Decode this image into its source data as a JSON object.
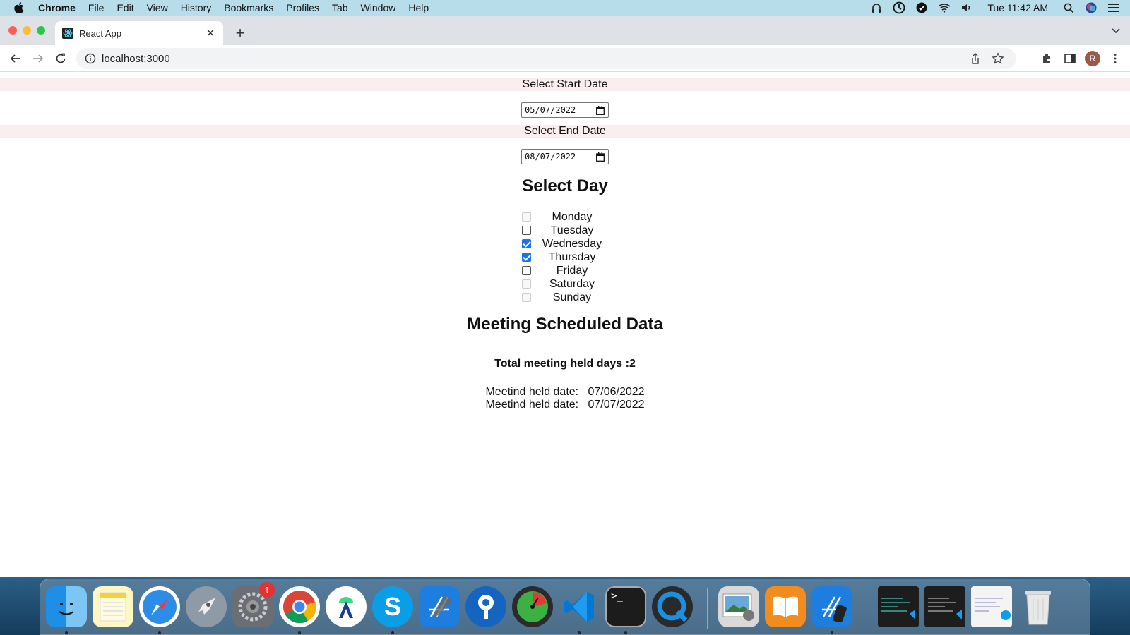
{
  "menubar": {
    "app": "Chrome",
    "items": [
      "File",
      "Edit",
      "View",
      "History",
      "Bookmarks",
      "Profiles",
      "Tab",
      "Window",
      "Help"
    ],
    "clock": "Tue 11:42 AM"
  },
  "browser": {
    "tab_title": "React App",
    "url": "localhost:3000",
    "avatar_initial": "R"
  },
  "page": {
    "start_label": "Select Start Date",
    "start_value": "05/07/2022",
    "end_label": "Select End Date",
    "end_value": "08/07/2022",
    "select_day_heading": "Select Day",
    "days": [
      {
        "label": "Monday",
        "checked": false,
        "disabled": true
      },
      {
        "label": "Tuesday",
        "checked": false,
        "disabled": false
      },
      {
        "label": "Wednesday",
        "checked": true,
        "disabled": false
      },
      {
        "label": "Thursday",
        "checked": true,
        "disabled": false
      },
      {
        "label": "Friday",
        "checked": false,
        "disabled": false
      },
      {
        "label": "Saturday",
        "checked": false,
        "disabled": true
      },
      {
        "label": "Sunday",
        "checked": false,
        "disabled": true
      }
    ],
    "meeting_heading": "Meeting Scheduled Data",
    "total_text": "Total meeting held days :2",
    "held_rows": [
      "Meetind held date:   07/06/2022",
      "Meetind held date:   07/07/2022"
    ]
  },
  "dock": {
    "apps": [
      "finder-icon",
      "notes-icon",
      "safari-icon",
      "launchpad-icon",
      "system-preferences-icon",
      "chrome-icon",
      "android-studio-icon",
      "skype-icon",
      "xcode-icon",
      "sourcetree-icon",
      "istat-icon",
      "vscode-icon",
      "terminal-icon",
      "quicktime-icon",
      "preview-icon",
      "books-icon",
      "simulator-icon",
      "window-thumbnail-icon",
      "window-thumbnail-icon",
      "window-thumbnail-icon",
      "trash-icon"
    ],
    "badge": "1"
  },
  "colors": {
    "menubar": "#b7dcea",
    "tabstrip": "#dee1e6",
    "label_band": "#fbeeee",
    "checkbox_accent": "#1a73e8"
  }
}
